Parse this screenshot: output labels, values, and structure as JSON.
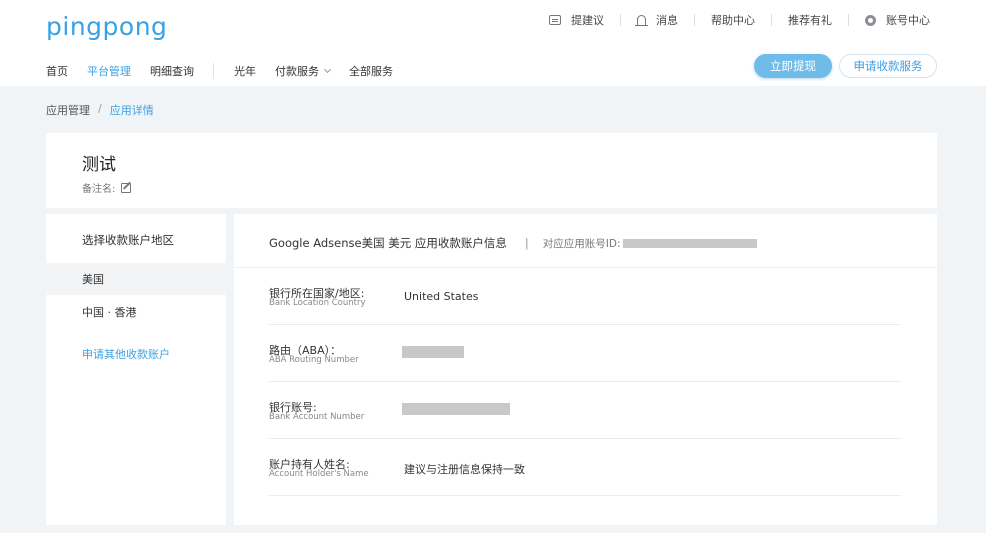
{
  "header": {
    "logo": "pingpong",
    "topbar": {
      "suggest": "提建议",
      "messages": "消息",
      "help": "帮助中心",
      "referral": "推荐有礼",
      "account": "账号中心"
    },
    "nav": {
      "home": "首页",
      "platform": "平台管理",
      "details": "明细查询",
      "guangnian": "光年",
      "payment": "付款服务",
      "all_services": "全部服务"
    },
    "buttons": {
      "withdraw": "立即提现",
      "apply": "申请收款服务"
    }
  },
  "breadcrumb": {
    "parent": "应用管理",
    "separator": "/",
    "current": "应用详情"
  },
  "app": {
    "title": "测试",
    "remark_label": "备注名:"
  },
  "left": {
    "heading": "选择收款账户地区",
    "regions": [
      "美国",
      "中国 · 香港"
    ],
    "selected": "美国",
    "apply_link": "申请其他收款账户"
  },
  "right": {
    "heading": "Google Adsense美国 美元 应用收款账户信息",
    "divider": "|",
    "id_label": "对应应用账号ID:",
    "rows": [
      {
        "zh": "银行所在国家/地区:",
        "en": "Bank Location Country",
        "value": "United States"
      },
      {
        "zh": "路由（ABA）：",
        "en": "ABA Routing Number",
        "value": ""
      },
      {
        "zh": "银行账号:",
        "en": "Bank Account Number",
        "value": ""
      },
      {
        "zh": "账户持有人姓名:",
        "en": "Account Holder's Name",
        "value": "建议与注册信息保持一致"
      }
    ]
  },
  "colors": {
    "accent": "#3aa1e6",
    "accent_button": "#6fbbea",
    "background": "#f1f4f7",
    "redacted": "#c8c8c8"
  }
}
